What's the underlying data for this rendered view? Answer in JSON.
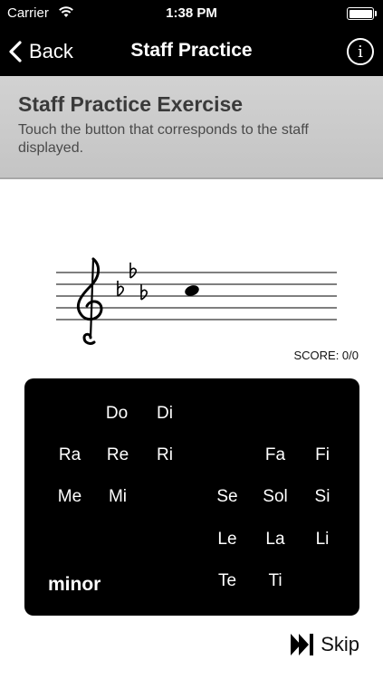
{
  "status_bar": {
    "carrier": "Carrier",
    "time": "1:38 PM"
  },
  "nav": {
    "back_label": "Back",
    "title": "Staff Practice",
    "info_icon": "i"
  },
  "header": {
    "title": "Staff Practice Exercise",
    "subtitle": "Touch the button that corresponds to the staff displayed."
  },
  "staff": {
    "clef": "treble",
    "key_signature": "3 flats",
    "note_icon": "whole-note"
  },
  "score": "SCORE: 0/0",
  "panel": {
    "syllables": [
      "Do",
      "Di",
      "Ra",
      "Re",
      "Ri",
      "Fa",
      "Fi",
      "Me",
      "Mi",
      "Se",
      "Sol",
      "Si",
      "Le",
      "La",
      "Li",
      "Te",
      "Ti"
    ],
    "minor_label": "minor"
  },
  "skip_label": "Skip",
  "colors": {
    "bar_background": "#000000",
    "header_gray": "#cbcbcb",
    "panel_background": "#000000"
  }
}
